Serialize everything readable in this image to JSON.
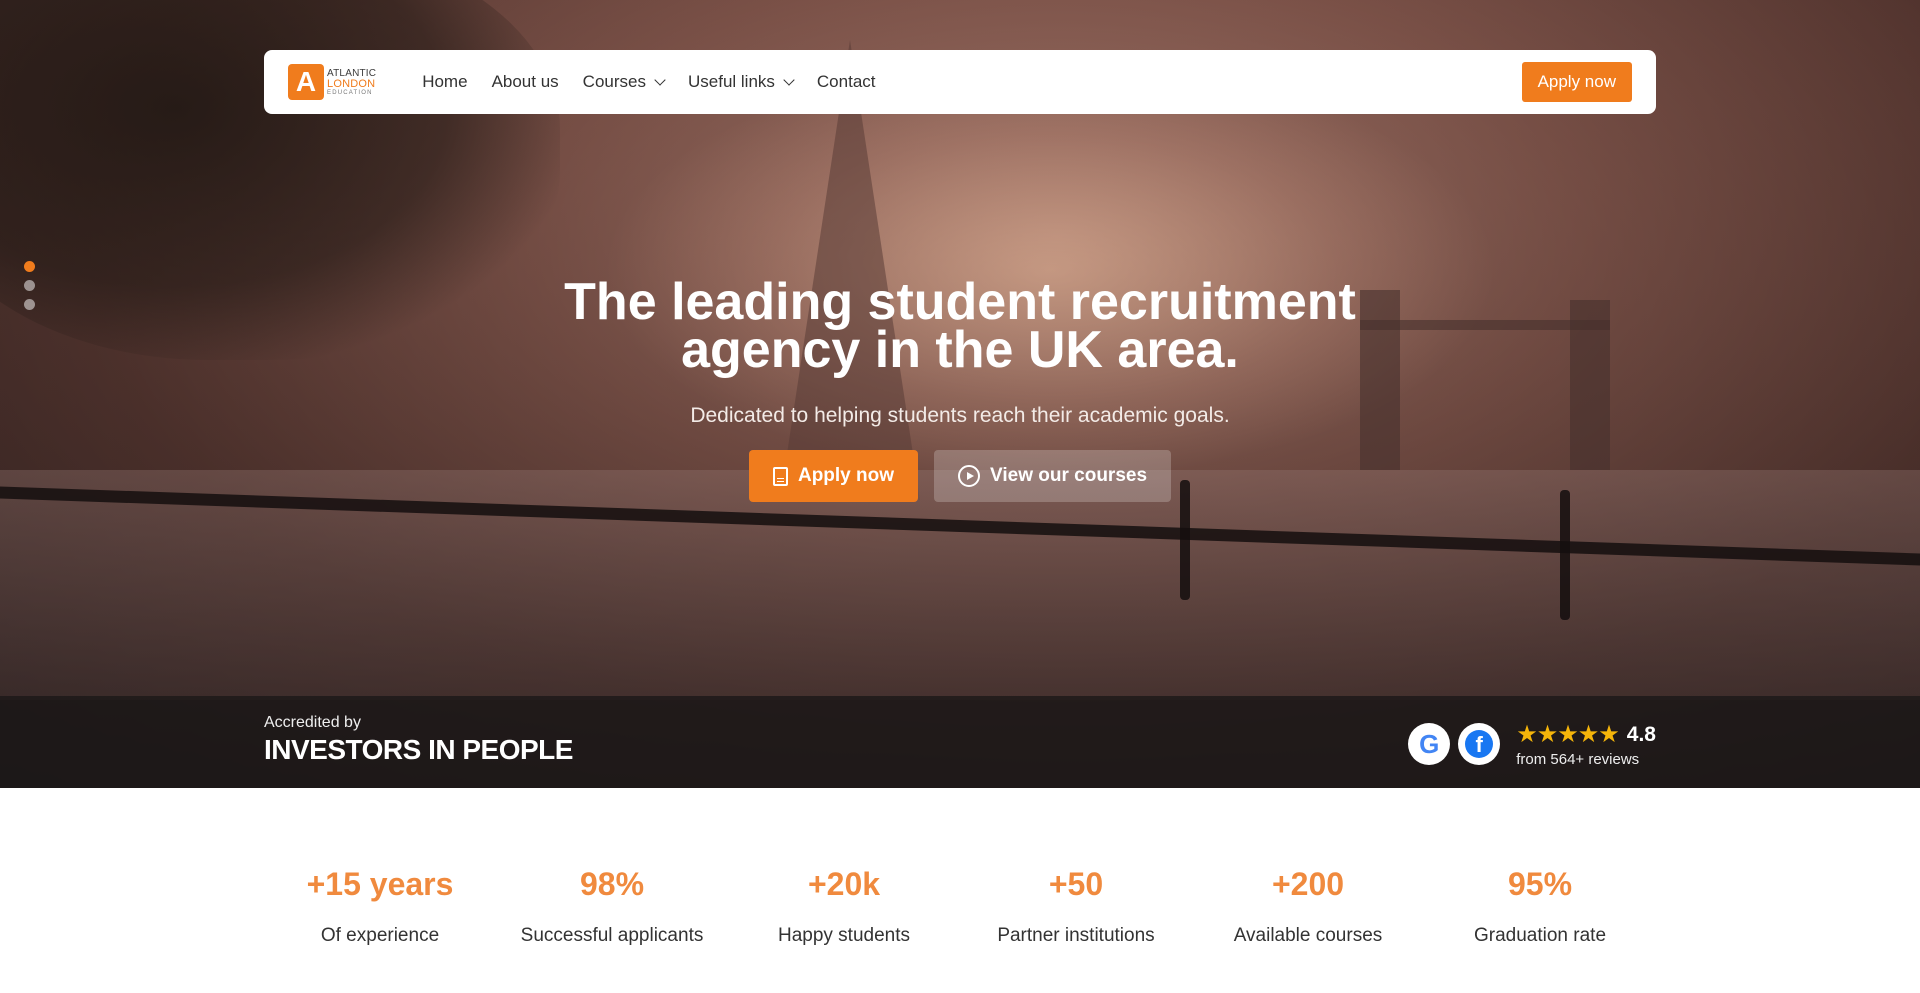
{
  "colors": {
    "accent": "#f07c1d",
    "stat_value": "#f08a3e",
    "star": "#f5b50a"
  },
  "logo": {
    "mark": "A",
    "line1": "ATLANTIC",
    "line2": "LONDON",
    "line3": "EDUCATION"
  },
  "nav": {
    "links": [
      {
        "label": "Home"
      },
      {
        "label": "About us"
      },
      {
        "label": "Courses",
        "dropdown": true
      },
      {
        "label": "Useful links",
        "dropdown": true
      },
      {
        "label": "Contact"
      }
    ],
    "apply_label": "Apply now"
  },
  "hero": {
    "title": "The leading student recruitment agency in the UK area.",
    "subtitle": "Dedicated to helping students reach their academic goals.",
    "primary_button": "Apply now",
    "secondary_button": "View our courses",
    "slides": 3,
    "active_slide": 1
  },
  "accreditation": {
    "label": "Accredited by",
    "org": "INVESTORS IN PEOPLE"
  },
  "reviews": {
    "google_icon": "google-icon",
    "facebook_icon": "facebook-icon",
    "stars": "★★★★★",
    "rating": "4.8",
    "count_text": "from 564+ reviews"
  },
  "stats": [
    {
      "value": "+15 years",
      "label": "Of experience"
    },
    {
      "value": "98%",
      "label": "Successful applicants"
    },
    {
      "value": "+20k",
      "label": "Happy students"
    },
    {
      "value": "+50",
      "label": "Partner institutions"
    },
    {
      "value": "+200",
      "label": "Available courses"
    },
    {
      "value": "95%",
      "label": "Graduation rate"
    }
  ]
}
